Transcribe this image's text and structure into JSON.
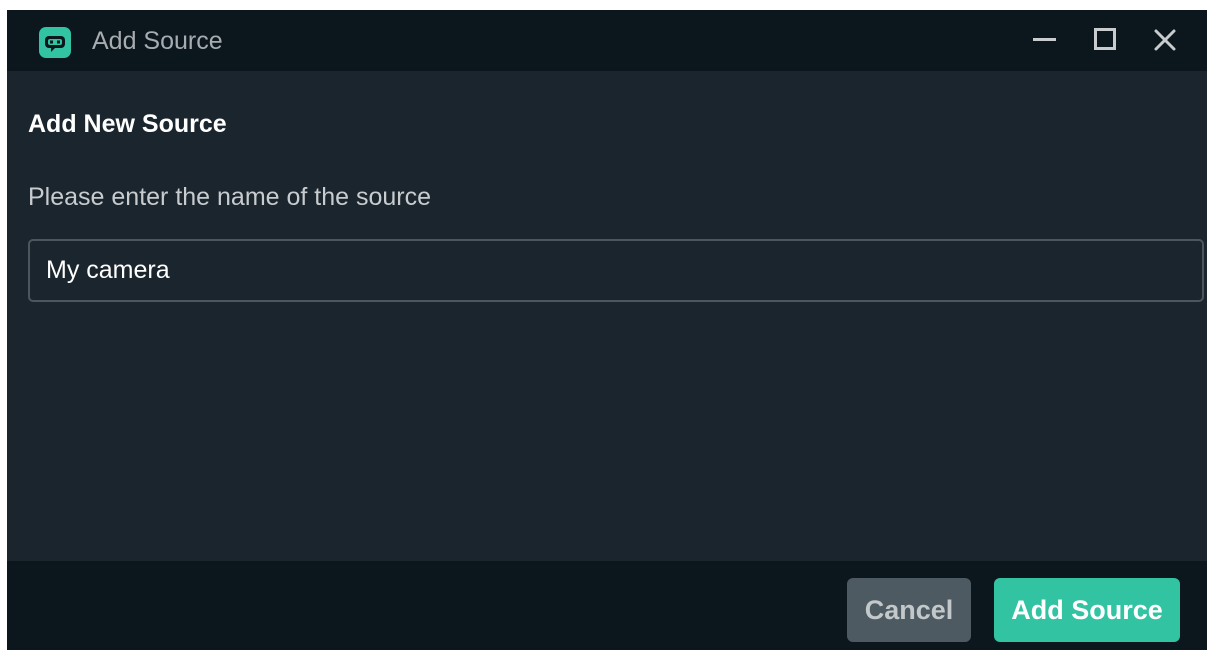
{
  "window": {
    "title": "Add Source",
    "app_icon": "streamlabs-robot-icon",
    "controls": {
      "minimize_icon": "minimize-icon",
      "maximize_icon": "maximize-icon",
      "close_icon": "close-icon"
    }
  },
  "dialog": {
    "heading": "Add New Source",
    "prompt": "Please enter the name of the source",
    "source_name_value": "My camera"
  },
  "footer": {
    "cancel_label": "Cancel",
    "add_label": "Add Source"
  },
  "colors": {
    "titlebar_bg": "#0c161d",
    "body_bg": "#1b252d",
    "accent": "#31c3a2",
    "cancel_bg": "#4e5a61",
    "input_border": "#4c565c"
  }
}
